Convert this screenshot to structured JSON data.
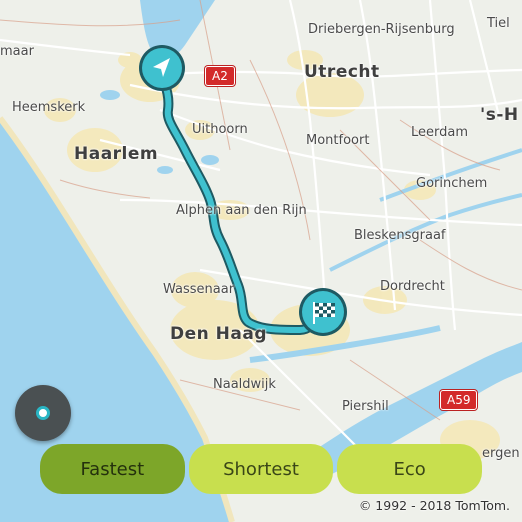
{
  "map": {
    "places": [
      {
        "id": "driebergen",
        "label": "Driebergen-Rijsenburg",
        "style": "small"
      },
      {
        "id": "tiel",
        "label": "Tiel",
        "style": "small"
      },
      {
        "id": "maar",
        "label": "maar",
        "style": "small"
      },
      {
        "id": "utrecht",
        "label": "Utrecht",
        "style": "big"
      },
      {
        "id": "heemskerk",
        "label": "Heemskerk",
        "style": "small"
      },
      {
        "id": "s-h",
        "label": "'s-H",
        "style": "big"
      },
      {
        "id": "haarlem",
        "label": "Haarlem",
        "style": "big"
      },
      {
        "id": "uithoorn",
        "label": "Uithoorn",
        "style": "small"
      },
      {
        "id": "leerdam",
        "label": "Leerdam",
        "style": "small"
      },
      {
        "id": "montfoort",
        "label": "Montfoort",
        "style": "small"
      },
      {
        "id": "gorinchem",
        "label": "Gorinchem",
        "style": "small"
      },
      {
        "id": "alphen",
        "label": "Alphen aan den Rijn",
        "style": "small"
      },
      {
        "id": "bleskensgraaf",
        "label": "Bleskensgraaf",
        "style": "small"
      },
      {
        "id": "dordrecht",
        "label": "Dordrecht",
        "style": "small"
      },
      {
        "id": "wassenaar",
        "label": "Wassenaar",
        "style": "small"
      },
      {
        "id": "denhaag",
        "label": "Den Haag",
        "style": "big"
      },
      {
        "id": "naaldwijk",
        "label": "Naaldwijk",
        "style": "small"
      },
      {
        "id": "piershil",
        "label": "Piershil",
        "style": "small"
      },
      {
        "id": "bergen",
        "label": "ergen",
        "style": "small"
      }
    ],
    "road_shields": [
      {
        "id": "a2",
        "label": "A2"
      },
      {
        "id": "a59",
        "label": "A59"
      }
    ],
    "colors": {
      "sea": "#9fd3ee",
      "land": "#eef0ea",
      "urban": "#f3e6b5",
      "route": "#3fc1cf",
      "route_outline": "#1e5a63",
      "road": "#ffffff",
      "shield": "#d32a2a"
    },
    "icons": {
      "start": "navigation-arrow-icon",
      "destination": "checkered-flag-icon",
      "locate": "current-location-icon"
    }
  },
  "route_options": {
    "buttons": [
      {
        "label": "Fastest",
        "active": true
      },
      {
        "label": "Shortest",
        "active": false
      },
      {
        "label": "Eco",
        "active": false
      }
    ]
  },
  "copyright": "© 1992 - 2018 TomTom."
}
